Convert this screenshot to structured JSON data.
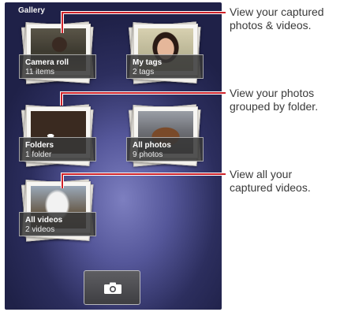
{
  "app": {
    "title": "Gallery"
  },
  "albums": [
    {
      "name": "Camera roll",
      "count": "11 items"
    },
    {
      "name": "My tags",
      "count": "2 tags"
    },
    {
      "name": "Folders",
      "count": "1 folder"
    },
    {
      "name": "All photos",
      "count": "9 photos"
    },
    {
      "name": "All videos",
      "count": "2 videos"
    }
  ],
  "toolbar": {
    "camera_icon": "camera-icon"
  },
  "callouts": [
    {
      "line1": "View your captured",
      "line2": "photos & videos."
    },
    {
      "line1": "View your photos",
      "line2": "grouped by folder."
    },
    {
      "line1": "View all your",
      "line2": "captured videos."
    }
  ],
  "colors": {
    "callout_line": "#d0232a",
    "screen_bg": "#2c2e5e"
  }
}
